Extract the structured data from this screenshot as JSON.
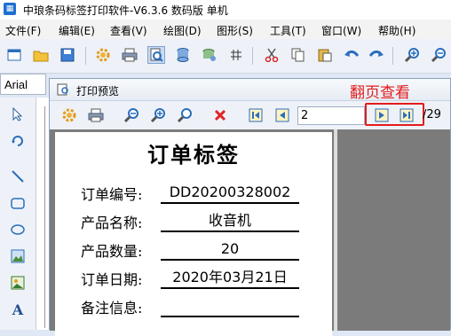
{
  "app": {
    "title": "中琅条码标签打印软件-V6.3.6 数码版 单机"
  },
  "menu": [
    "文件(F)",
    "编辑(E)",
    "查看(V)",
    "绘图(D)",
    "图形(S)",
    "工具(T)",
    "窗口(W)",
    "帮助(H)"
  ],
  "font": {
    "name": "Arial"
  },
  "preview": {
    "title": "打印预览",
    "annotation": "翻页查看",
    "page_input": "2",
    "page_total": "/29"
  },
  "label": {
    "title": "订单标签",
    "rows": [
      {
        "key": "订单编号:",
        "value": "DD20200328002"
      },
      {
        "key": "产品名称:",
        "value": "收音机"
      },
      {
        "key": "产品数量:",
        "value": "20"
      },
      {
        "key": "订单日期:",
        "value": "2020年03月21日"
      },
      {
        "key": "备注信息:",
        "value": ""
      }
    ]
  },
  "colors": {
    "accent": "#e31c1c",
    "toolbar_bg": "#eef2f8",
    "preview_bg": "#7b7b7b"
  }
}
